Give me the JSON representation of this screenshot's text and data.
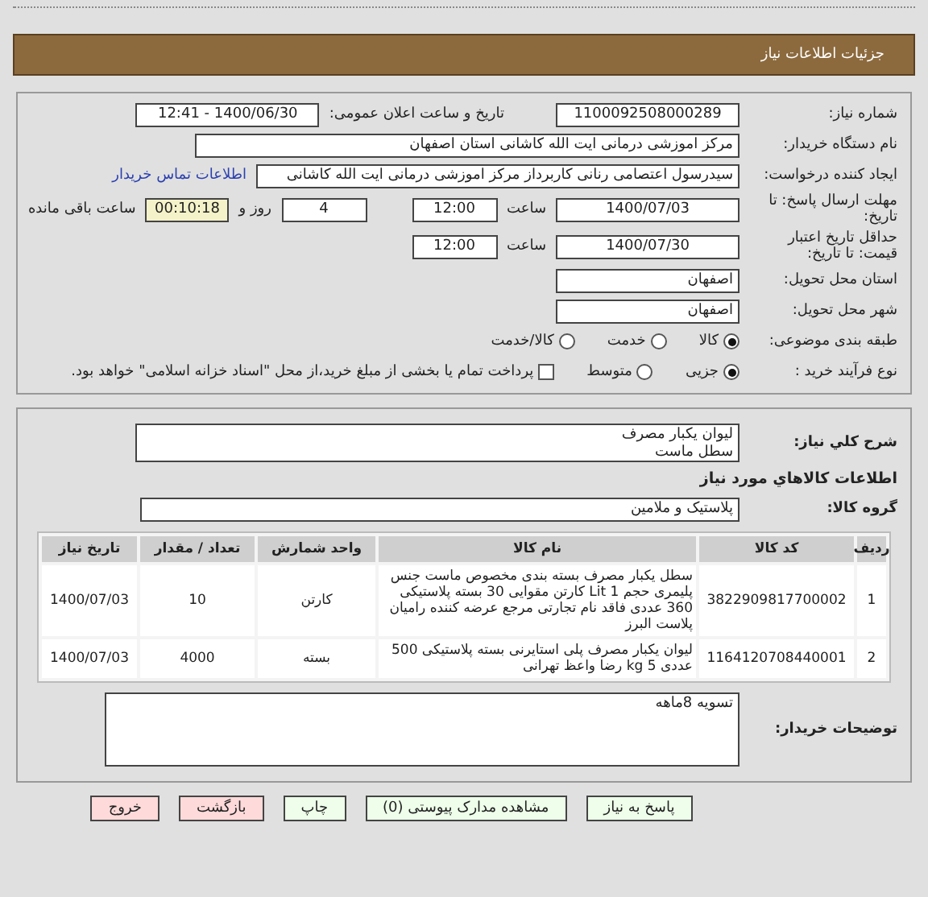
{
  "header": {
    "title": "جزئیات اطلاعات نیاز"
  },
  "need_number": {
    "label": "شماره نیاز:",
    "value": "1100092508000289"
  },
  "announce": {
    "label": "تاریخ و ساعت اعلان عمومی:",
    "value": "1400/06/30 - 12:41"
  },
  "buyer_org": {
    "label": "نام دستگاه خریدار:",
    "value": "مرکز اموزشی درمانی ایت الله کاشانی استان اصفهان"
  },
  "requester": {
    "label": "ایجاد کننده درخواست:",
    "value": "سیدرسول اعتصامی رنانی کاربرداز مرکز اموزشی درمانی ایت الله کاشانی",
    "link": "اطلاعات تماس خریدار"
  },
  "deadline": {
    "label": "مهلت ارسال پاسخ: تا تاریخ:",
    "date": "1400/07/03",
    "time_label": "ساعت",
    "time": "12:00",
    "days": "4",
    "days_label": "روز و",
    "remaining": "00:10:18",
    "remaining_label": "ساعت باقی مانده"
  },
  "validity": {
    "label": "حداقل تاریخ اعتبار قیمت: تا تاریخ:",
    "date": "1400/07/30",
    "time_label": "ساعت",
    "time": "12:00"
  },
  "province": {
    "label": "استان محل تحویل:",
    "value": "اصفهان"
  },
  "city": {
    "label": "شهر محل تحویل:",
    "value": "اصفهان"
  },
  "classification": {
    "label": "طبقه بندی موضوعی:",
    "options": [
      {
        "label": "کالا",
        "selected": true
      },
      {
        "label": "خدمت",
        "selected": false
      },
      {
        "label": "کالا/خدمت",
        "selected": false
      }
    ]
  },
  "process": {
    "label": "نوع فرآیند خرید :",
    "options": [
      {
        "label": "جزیی",
        "selected": true
      },
      {
        "label": "متوسط",
        "selected": false
      }
    ],
    "payment_option": {
      "label": "پرداخت تمام یا بخشی از مبلغ خرید،از محل \"اسناد خزانه اسلامی\" خواهد بود.",
      "checked": false
    }
  },
  "description": {
    "label": "شرح کلي نياز:",
    "lines": [
      "لیوان یکبار مصرف",
      "سطل ماست"
    ]
  },
  "goods_heading": "اطلاعات کالاهاي مورد نياز",
  "goods_group": {
    "label": "گروه کالا:",
    "value": "پلاستیک و ملامین"
  },
  "table": {
    "columns": [
      "ردیف",
      "کد کالا",
      "نام کالا",
      "واحد شمارش",
      "تعداد / مقدار",
      "تاریخ نیاز"
    ],
    "rows": [
      [
        "1",
        "3822909817700002",
        "سطل یکبار مصرف بسته بندی مخصوص ماست جنس پلیمری حجم 1 Lit کارتن مقوایی 30 بسته پلاستیکی 360 عددی فاقد نام تجارتی مرجع عرضه کننده رامیان پلاست البرز",
        "کارتن",
        "10",
        "1400/07/03"
      ],
      [
        "2",
        "1164120708440001",
        "لیوان یکبار مصرف پلی استایرنی بسته پلاستیکی 500 عددی 5 kg رضا واعظ تهرانی",
        "بسته",
        "4000",
        "1400/07/03"
      ]
    ]
  },
  "buyer_notes": {
    "label": "توضیحات خریدار:",
    "value": "تسویه 8ماهه"
  },
  "buttons": [
    {
      "label": "پاسخ به نیاز",
      "kind": "normal"
    },
    {
      "label": "مشاهده مدارک پیوستی (0)",
      "kind": "normal"
    },
    {
      "label": "چاپ",
      "kind": "normal"
    },
    {
      "label": "بازگشت",
      "kind": "danger"
    },
    {
      "label": "خروج",
      "kind": "danger"
    }
  ]
}
